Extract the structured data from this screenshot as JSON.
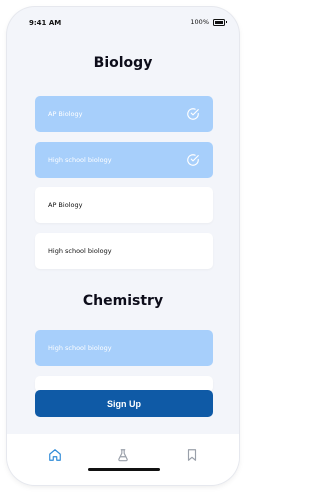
{
  "status_bar": {
    "time": "9:41 AM",
    "battery": "100%"
  },
  "sections": [
    {
      "title": "Biology",
      "options": [
        {
          "label": "AP Biology",
          "selected": true
        },
        {
          "label": "High school biology",
          "selected": true
        },
        {
          "label": "AP Biology",
          "selected": false
        },
        {
          "label": "High school biology",
          "selected": false
        }
      ]
    },
    {
      "title": "Chemistry",
      "options": [
        {
          "label": "High school biology",
          "selected": true
        }
      ]
    }
  ],
  "signup_button": {
    "label": "Sign Up"
  },
  "tab_bar": {
    "tabs": [
      {
        "icon": "home-icon",
        "active": true
      },
      {
        "icon": "flask-icon",
        "active": false
      },
      {
        "icon": "bookmark-icon",
        "active": false
      }
    ]
  },
  "colors": {
    "selected_bg": "#a7cffb",
    "primary": "#0f5aa6",
    "active_tab": "#2f8bd8",
    "inactive_tab": "#9aa0aa"
  }
}
